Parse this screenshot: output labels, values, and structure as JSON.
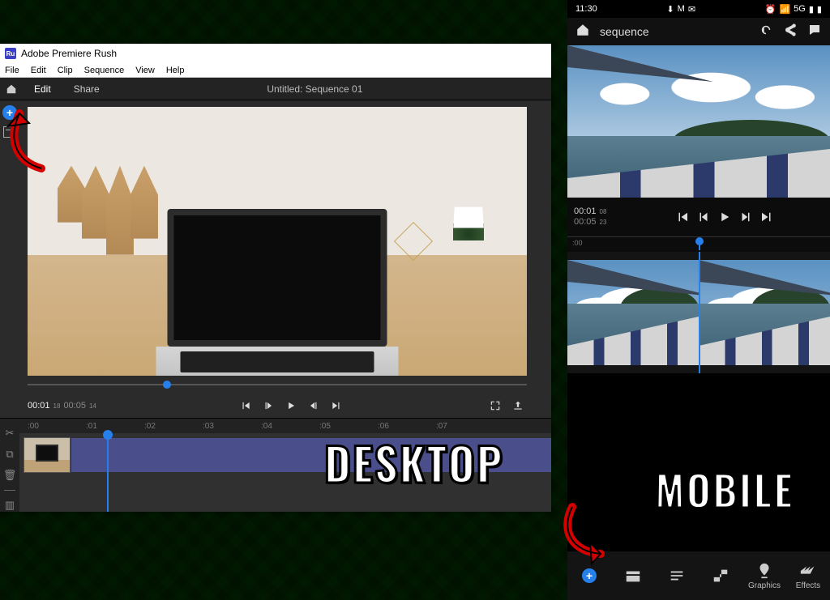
{
  "desktop": {
    "window_title": "Adobe Premiere Rush",
    "menu": [
      "File",
      "Edit",
      "Clip",
      "Sequence",
      "View",
      "Help"
    ],
    "tabs": {
      "home": "",
      "edit": "Edit",
      "share": "Share"
    },
    "document_title": "Untitled: Sequence 01",
    "timecode": {
      "current": "00:01",
      "current_frames": "18",
      "duration": "00:05",
      "duration_frames": "14"
    },
    "ruler": [
      ":00",
      ":01",
      ":02",
      ":03",
      ":04",
      ":05",
      ":06",
      ":07"
    ]
  },
  "mobile": {
    "status_time": "11:30",
    "breadcrumb": "sequence",
    "timecode": {
      "current": "00:01",
      "current_frames": "08",
      "duration": "00:05",
      "duration_frames": "23"
    },
    "ruler": ":00",
    "nav": {
      "graphics": "Graphics",
      "effects": "Effects"
    }
  },
  "labels": {
    "desktop": "DESKTOP",
    "mobile": "MOBILE"
  }
}
